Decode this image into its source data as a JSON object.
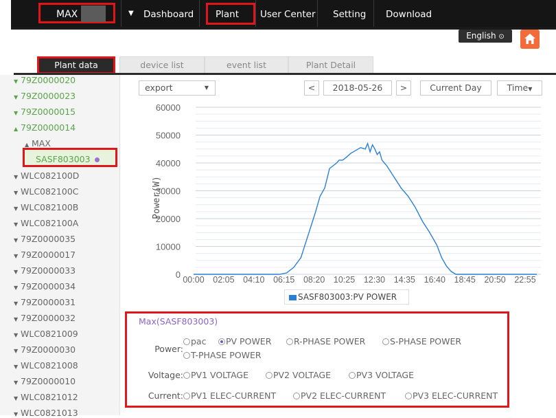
{
  "nav": {
    "brand": "MAX",
    "items": [
      "Dashboard",
      "Plant",
      "User Center",
      "Setting",
      "Download"
    ]
  },
  "lang": {
    "label": "English",
    "icon": "chevron-circle-icon"
  },
  "home": {
    "icon": "home-icon",
    "color": "#f26b3a"
  },
  "tabs": [
    "Plant data",
    "device list",
    "event list",
    "Plant Detail"
  ],
  "tree": [
    "79Z0000020",
    "79Z0000023",
    "79Z0000015",
    "79Z0000014",
    "MAX",
    "SASF803003",
    "WLC082100D",
    "WLC082100C",
    "WLC082100B",
    "WLC082100A",
    "79Z0000035",
    "79Z0000017",
    "79Z0000033",
    "79Z0000034",
    "79Z0000031",
    "79Z0000032",
    "WLC0821009",
    "79Z0000030",
    "WLC0821008",
    "79Z0000010",
    "WLC0821012",
    "WLC0821013"
  ],
  "controls": {
    "export": "export",
    "date": "2018-05-26",
    "prev": "<",
    "next": ">",
    "current_day": "Current Day",
    "time": "Time"
  },
  "chart_data": {
    "type": "line",
    "ylabel": "Power(W)",
    "ylim": [
      0,
      60000
    ],
    "yticks": [
      "0",
      "10000",
      "20000",
      "30000",
      "40000",
      "50000",
      "60000"
    ],
    "xticks": [
      "00:00",
      "02:05",
      "04:10",
      "06:15",
      "08:20",
      "10:25",
      "12:30",
      "14:35",
      "16:40",
      "18:45",
      "20:50",
      "22:55"
    ],
    "series": [
      {
        "name": "SASF803003:PV POWER",
        "color": "#2a7fd4",
        "x": [
          "00:00",
          "06:00",
          "06:30",
          "07:00",
          "07:30",
          "08:00",
          "08:30",
          "08:50",
          "09:10",
          "09:30",
          "10:00",
          "10:10",
          "10:25",
          "10:40",
          "11:00",
          "11:20",
          "11:40",
          "12:00",
          "12:10",
          "12:20",
          "12:30",
          "12:40",
          "12:50",
          "13:00",
          "13:10",
          "13:30",
          "14:00",
          "14:30",
          "15:00",
          "15:30",
          "16:00",
          "16:30",
          "17:00",
          "17:20",
          "17:40",
          "18:00",
          "18:20",
          "23:59"
        ],
        "values": [
          0,
          0,
          500,
          2500,
          6000,
          14000,
          22000,
          28000,
          31000,
          38000,
          40000,
          41000,
          41000,
          42000,
          43500,
          44500,
          45500,
          45000,
          47000,
          44000,
          46500,
          45000,
          43000,
          44000,
          41000,
          39000,
          35000,
          31000,
          28000,
          24000,
          19000,
          15000,
          10500,
          6000,
          3000,
          1000,
          0,
          0
        ]
      }
    ]
  },
  "params": {
    "title": "Max(SASF803003)",
    "power_label": "Power:",
    "power_options": [
      "pac",
      "PV POWER",
      "R-PHASE POWER",
      "S-PHASE POWER",
      "T-PHASE POWER"
    ],
    "power_selected": "PV POWER",
    "voltage_label": "Voltage:",
    "voltage_options": [
      "PV1 VOLTAGE",
      "PV2 VOLTAGE",
      "PV3 VOLTAGE"
    ],
    "current_label": "Current:",
    "current_options": [
      "PV1 ELEC-CURRENT",
      "PV2 ELEC-CURRENT",
      "PV3 ELEC-CURRENT"
    ]
  }
}
